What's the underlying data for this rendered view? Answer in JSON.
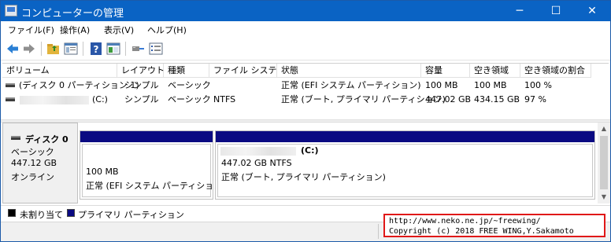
{
  "window": {
    "title": "コンピューターの管理",
    "controls": {
      "minimize": "─",
      "maximize": "☐",
      "close": "✕"
    }
  },
  "menu": [
    {
      "label": "ファイル(F)"
    },
    {
      "label": "操作(A)"
    },
    {
      "label": "表示(V)"
    },
    {
      "label": "ヘルプ(H)"
    }
  ],
  "toolbar": {
    "buttons": [
      "back-arrow-icon",
      "forward-arrow-icon",
      "up-folder-icon",
      "properties-icon",
      "help-icon",
      "console-tree-icon",
      "connect-icon",
      "settings-icon"
    ]
  },
  "volume_list": {
    "columns": [
      "ボリューム",
      "レイアウト",
      "種類",
      "ファイル システム",
      "状態",
      "容量",
      "空き領域",
      "空き領域の割合"
    ],
    "rows": [
      {
        "volume": "(ディスク 0 パーティション 1)",
        "layout": "シンプル",
        "type": "ベーシック",
        "fs": "",
        "status": "正常 (EFI システム パーティション)",
        "capacity": "100 MB",
        "free": "100 MB",
        "free_pct": "100 %"
      },
      {
        "volume": "(C:)",
        "layout": "シンプル",
        "type": "ベーシック",
        "fs": "NTFS",
        "status": "正常 (ブート, プライマリ パーティション)",
        "capacity": "447.02 GB",
        "free": "434.15 GB",
        "free_pct": "97 %"
      }
    ]
  },
  "disk": {
    "name": "ディスク 0",
    "type": "ベーシック",
    "size": "447.12 GB",
    "state": "オンライン",
    "partitions": [
      {
        "title": "",
        "size": "100 MB",
        "status": "正常 (EFI システム パーティション)"
      },
      {
        "title": "(C:)",
        "size": "447.02 GB NTFS",
        "status": "正常 (ブート, プライマリ パーティション)"
      }
    ]
  },
  "legend": [
    {
      "label": "未割り当て",
      "color": "#000000"
    },
    {
      "label": "プライマリ パーティション",
      "color": "#0a0a82"
    }
  ],
  "credit": {
    "line1": "http://www.neko.ne.jp/~freewing/",
    "line2": "Copyright (c) 2018 FREE WING,Y.Sakamoto"
  },
  "colors": {
    "titlebar": "#0a63c4",
    "partition_bar": "#0a0a82",
    "credit_border": "#e01818"
  }
}
